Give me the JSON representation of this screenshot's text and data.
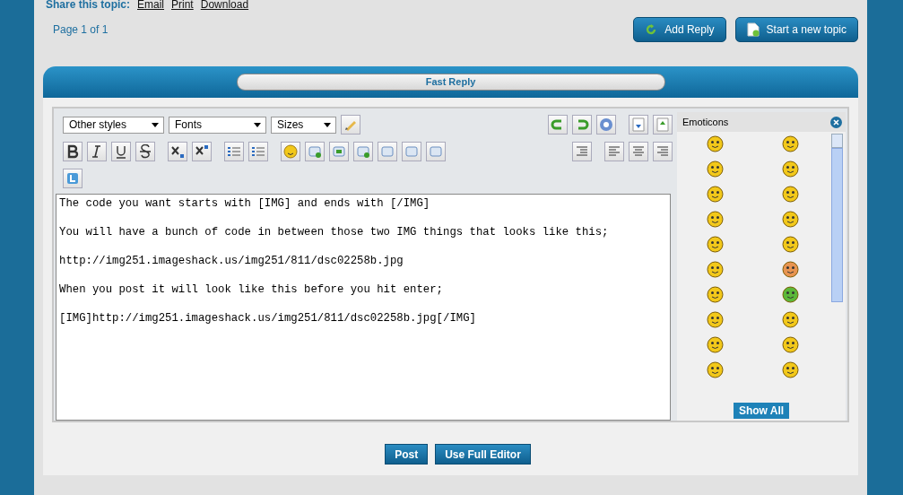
{
  "share": {
    "label": "Share this topic:",
    "links": [
      "Email",
      "Print",
      "Download"
    ]
  },
  "pagination": "Page 1 of 1",
  "actions": [
    {
      "label": "Add Reply",
      "kind": "reply"
    },
    {
      "label": "Start a new topic",
      "kind": "topic"
    }
  ],
  "panel": {
    "title": "Fast Reply"
  },
  "toolbar": {
    "dropdowns": [
      "Other styles",
      "Fonts",
      "Sizes"
    ]
  },
  "editor": {
    "value": "The code you want starts with [IMG] and ends with [/IMG]\n\nYou will have a bunch of code in between those two IMG things that looks like this;\n\nhttp://img251.imageshack.us/img251/811/dsc02258b.jpg\n\nWhen you post it will look like this before you hit enter;\n\n[IMG]http://img251.imageshack.us/img251/811/dsc02258b.jpg[/IMG]"
  },
  "emoticons": {
    "title": "Emoticons",
    "show_all": "Show All"
  },
  "buttons": [
    "Post",
    "Use Full Editor"
  ]
}
